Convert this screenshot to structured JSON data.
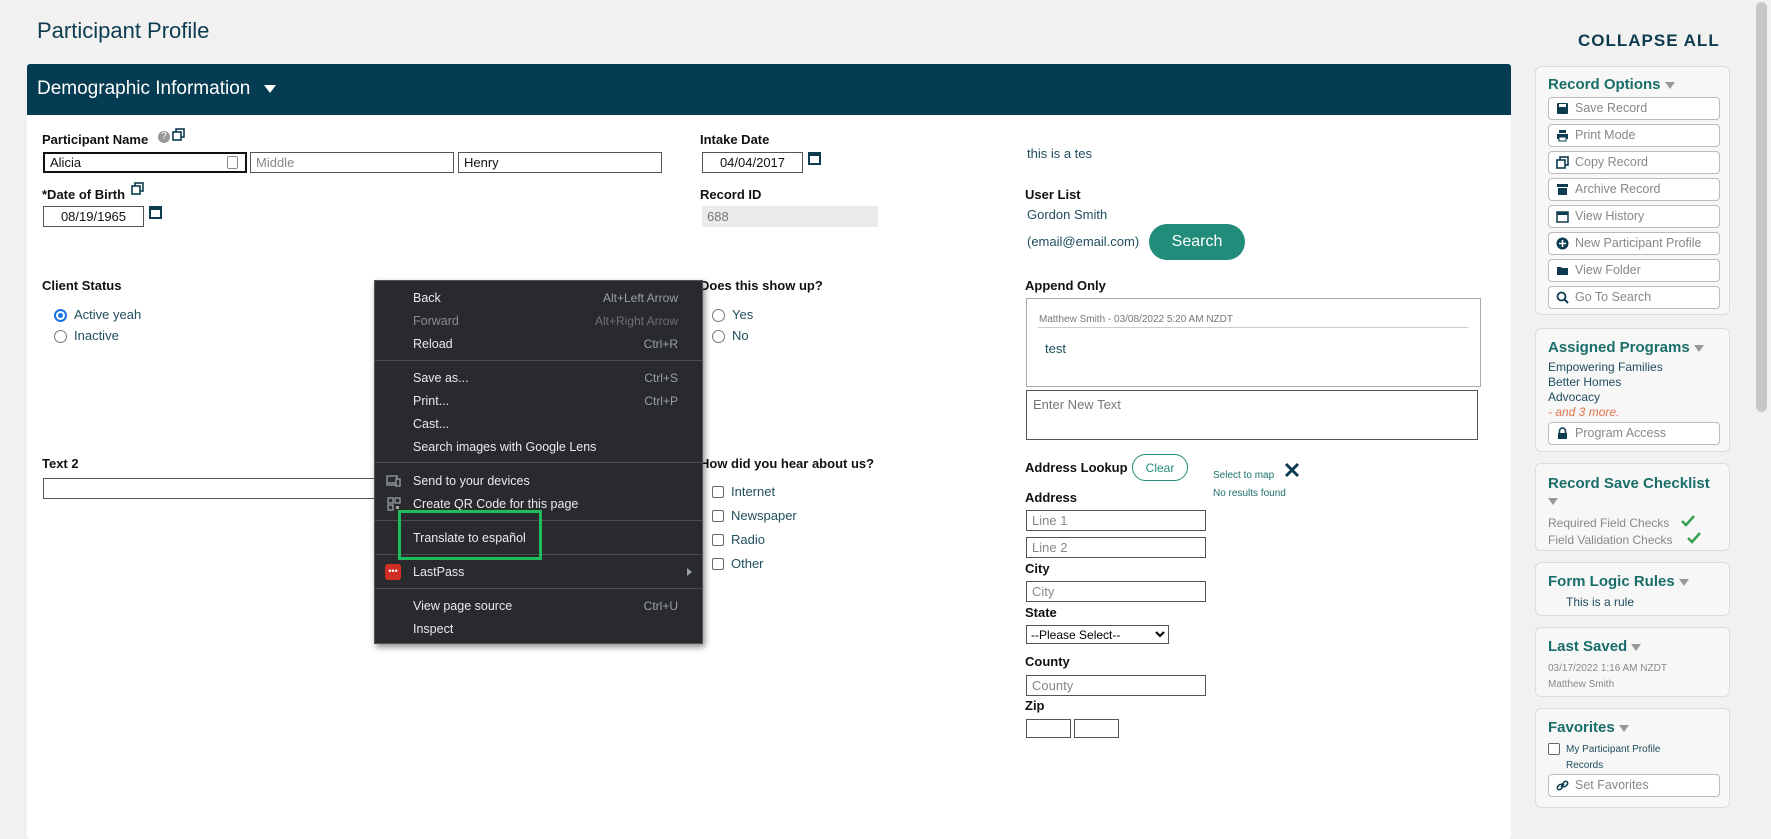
{
  "page": {
    "title": "Participant Profile",
    "collapse_all": "COLLAPSE ALL"
  },
  "panel": {
    "title": "Demographic Information"
  },
  "form": {
    "participant_name": {
      "label": "Participant Name",
      "first": "Alicia",
      "middle_placeholder": "Middle",
      "last": "Henry"
    },
    "dob": {
      "label": "*Date of Birth",
      "value": "08/19/1965"
    },
    "intake_date": {
      "label": "Intake Date",
      "value": "04/04/2017"
    },
    "record_id": {
      "label": "Record ID",
      "value": "688"
    },
    "note_text": "this is a tes",
    "user_list": {
      "label": "User List",
      "name": "Gordon Smith",
      "email": "(email@email.com)",
      "search_label": "Search"
    },
    "client_status": {
      "label": "Client Status",
      "options": [
        "Active yeah",
        "Inactive"
      ]
    },
    "show_up": {
      "label": "Does this show up?",
      "options": [
        "Yes",
        "No"
      ]
    },
    "append_only": {
      "label": "Append Only",
      "entry_meta": "Matthew Smith - 03/08/2022 5:20 AM NZDT",
      "entry_text": "test",
      "new_placeholder": "Enter New Text"
    },
    "text2": {
      "label": "Text 2"
    },
    "hear_about": {
      "label": "How did you hear about us?",
      "options": [
        "Internet",
        "Newspaper",
        "Radio",
        "Other"
      ]
    },
    "address": {
      "lookup_label": "Address Lookup",
      "clear_label": "Clear",
      "select_to_map": "Select to map",
      "no_results": "No results found",
      "address_label": "Address",
      "line1_placeholder": "Line 1",
      "line2_placeholder": "Line 2",
      "city_label": "City",
      "city_placeholder": "City",
      "state_label": "State",
      "state_selected": "--Please Select--",
      "county_label": "County",
      "county_placeholder": "County",
      "zip_label": "Zip"
    }
  },
  "sidebar": {
    "record_options": {
      "title": "Record Options",
      "buttons": [
        "Save Record",
        "Print Mode",
        "Copy Record",
        "Archive Record",
        "View History",
        "New Participant Profile",
        "View Folder",
        "Go To Search"
      ]
    },
    "assigned_programs": {
      "title": "Assigned Programs",
      "items": [
        "Empowering Families",
        "Better Homes",
        "Advocacy"
      ],
      "more": "- and 3 more.",
      "access_button": "Program Access"
    },
    "checklist": {
      "title": "Record Save Checklist",
      "items": [
        "Required Field Checks",
        "Field Validation Checks"
      ]
    },
    "logic_rules": {
      "title": "Form Logic Rules",
      "rule": "This is a rule"
    },
    "last_saved": {
      "title": "Last Saved",
      "date": "03/17/2022 1:16 AM NZDT",
      "user": "Matthew Smith"
    },
    "favorites": {
      "title": "Favorites",
      "item_line1": "My Participant Profile",
      "item_line2": "Records",
      "button": "Set Favorites"
    }
  },
  "context_menu": {
    "items": [
      {
        "label": "Back",
        "shortcut": "Alt+Left Arrow"
      },
      {
        "label": "Forward",
        "shortcut": "Alt+Right Arrow"
      },
      {
        "label": "Reload",
        "shortcut": "Ctrl+R"
      },
      {
        "label": "Save as...",
        "shortcut": "Ctrl+S"
      },
      {
        "label": "Print...",
        "shortcut": "Ctrl+P"
      },
      {
        "label": "Cast...",
        "shortcut": ""
      },
      {
        "label": "Search images with Google Lens",
        "shortcut": ""
      },
      {
        "label": "Send to your devices",
        "shortcut": ""
      },
      {
        "label": "Create QR Code for this page",
        "shortcut": ""
      },
      {
        "label": "Translate to español",
        "shortcut": ""
      },
      {
        "label": "LastPass",
        "shortcut": ""
      },
      {
        "label": "View page source",
        "shortcut": "Ctrl+U"
      },
      {
        "label": "Inspect",
        "shortcut": ""
      }
    ]
  },
  "colors": {
    "header": "#053c52",
    "accent": "#228c7a",
    "highlight": "#1fbc5e",
    "menu_bg": "#292a2d",
    "lastpass": "#d32d27"
  }
}
